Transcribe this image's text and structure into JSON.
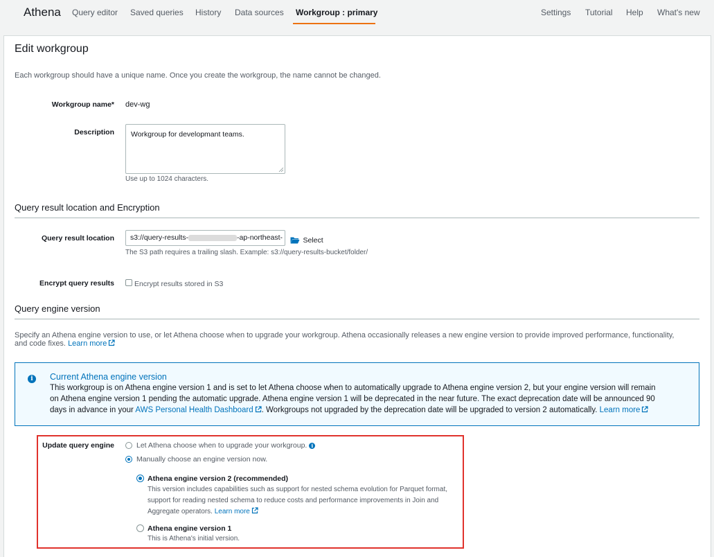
{
  "nav": {
    "brand": "Athena",
    "items": [
      "Query editor",
      "Saved queries",
      "History",
      "Data sources",
      "Workgroup : primary"
    ],
    "right_items": [
      "Settings",
      "Tutorial",
      "Help",
      "What's new"
    ]
  },
  "page": {
    "title": "Edit workgroup",
    "intro": "Each workgroup should have a unique name. Once you create the workgroup, the name cannot be changed."
  },
  "form": {
    "name_label": "Workgroup name*",
    "name_value": "dev-wg",
    "description_label": "Description",
    "description_value": "Workgroup for developmant teams.",
    "description_hint": "Use up to 1024 characters."
  },
  "result_section": {
    "heading": "Query result location and Encryption",
    "location_label": "Query result location",
    "location_prefix": "s3://query-results-",
    "location_suffix": "-ap-northeast-",
    "select_label": "Select",
    "location_hint": "The S3 path requires a trailing slash. Example: s3://query-results-bucket/folder/",
    "encrypt_label": "Encrypt query results",
    "encrypt_checkbox_label": "Encrypt results stored in S3"
  },
  "engine_section": {
    "heading": "Query engine version",
    "intro_line1": "Specify an Athena engine version to use, or let Athena choose when to upgrade your workgroup. Athena occasionally releases a new engine version to provide improved performance, functionality,",
    "intro_line2": "and code fixes.",
    "learn_more": "Learn more"
  },
  "info_box": {
    "title": "Current Athena engine version",
    "line1": "This workgroup is on Athena engine version 1 and is set to let Athena choose when to automatically upgrade to Athena engine version 2, but your engine version will remain",
    "line2": "on Athena engine version 1 pending the automatic upgrade. Athena engine version 1 will be deprecated in the near future. The exact deprecation date will be announced 90",
    "line3_pre": "days in advance in your",
    "dashboard_link": "AWS Personal Health Dashboard",
    "line3_post": ". Workgroups not upgraded by the deprecation date will be upgraded to version 2 automatically.",
    "learn_more": "Learn more"
  },
  "update_engine": {
    "label": "Update query engine",
    "option_auto": "Let Athena choose when to upgrade your workgroup.",
    "option_manual": "Manually choose an engine version now.",
    "v2_title": "Athena engine version 2 (recommended)",
    "v2_desc1": "This version includes capabilities such as support for nested schema evolution for Parquet format,",
    "v2_desc2": "support for reading nested schema to reduce costs and performance improvements in Join and",
    "v2_desc3": "Aggregate operators.",
    "v2_learn_more": "Learn more",
    "v1_title": "Athena engine version 1",
    "v1_desc": "This is Athena's initial version."
  },
  "colors": {
    "accent": "#0073bb",
    "nav_active_underline": "#ec7211",
    "highlight_border": "#e0322c"
  }
}
